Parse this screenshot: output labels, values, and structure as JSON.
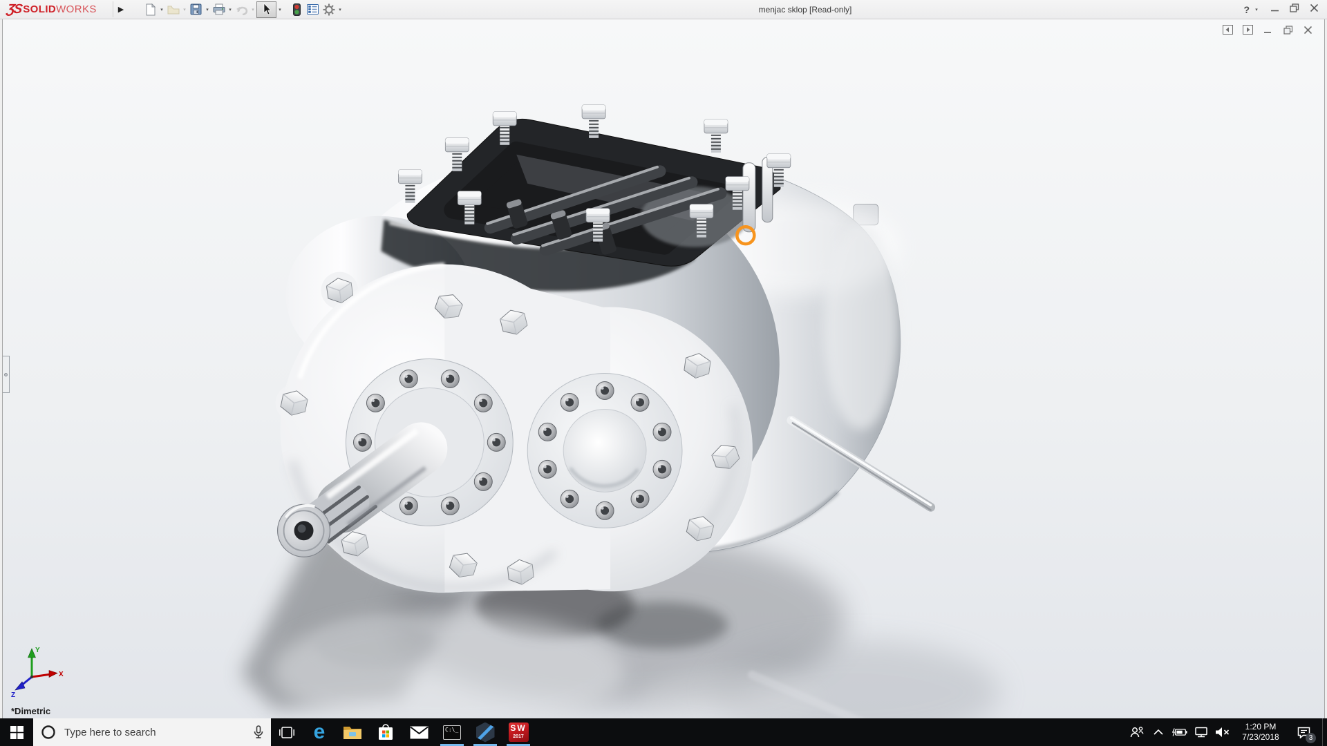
{
  "titlebar": {
    "brand": {
      "mark": "ƷS",
      "name_bold": "SOLID",
      "name_light": "WORKS"
    },
    "flyout_icon": "▶",
    "toolbar": {
      "caret_icon": "▾",
      "buttons": [
        {
          "name": "new-document",
          "enabled": true
        },
        {
          "name": "open",
          "enabled": false
        },
        {
          "name": "save",
          "enabled": true
        },
        {
          "name": "print",
          "enabled": true
        },
        {
          "name": "undo",
          "enabled": false
        },
        {
          "name": "select-tool",
          "state": "active"
        },
        {
          "name": "rebuild-traffic-light",
          "enabled": true
        },
        {
          "name": "display-pane",
          "enabled": true
        },
        {
          "name": "options-gear",
          "enabled": true
        }
      ]
    },
    "title": "menjac sklop [Read-only]",
    "window_controls": {
      "help": "?",
      "caret": "▾"
    }
  },
  "viewport": {
    "orientation_label": "*Dimetric",
    "triad": {
      "x_label": "X",
      "y_label": "Y",
      "z_label": "Z"
    },
    "annotation": {
      "type": "highlight-ring",
      "color": "#F7941E"
    },
    "model": {
      "subject": "gearbox assembly 3D model",
      "render": "chrome metallic with floor shadow and reflection"
    }
  },
  "taskbar": {
    "search": {
      "placeholder": "Type here to search"
    },
    "apps": [
      {
        "name": "microsoft-edge",
        "glyph": "e",
        "running": false
      },
      {
        "name": "file-explorer",
        "running": false
      },
      {
        "name": "microsoft-store",
        "running": false
      },
      {
        "name": "mail",
        "running": false
      },
      {
        "name": "command-prompt",
        "text": "C:\\_",
        "running": true
      },
      {
        "name": "hexagon-app",
        "running": true
      },
      {
        "name": "solidworks-2017",
        "label": "SW",
        "year": "2017",
        "running": true
      }
    ],
    "clock": {
      "time": "1:20 PM",
      "date": "7/23/2018"
    },
    "notification_badge": "3"
  },
  "colors": {
    "brand_red": "#CF2128",
    "highlight_orange": "#F7941E",
    "running_indicator": "#76B9ED",
    "taskbar_bg": "#0C0D0F",
    "store_tiles": [
      "#F25022",
      "#7FBA00",
      "#00A4EF",
      "#FFB900"
    ],
    "triad": {
      "x": "#C00000",
      "y": "#1E9E1E",
      "z": "#2020C8"
    }
  }
}
